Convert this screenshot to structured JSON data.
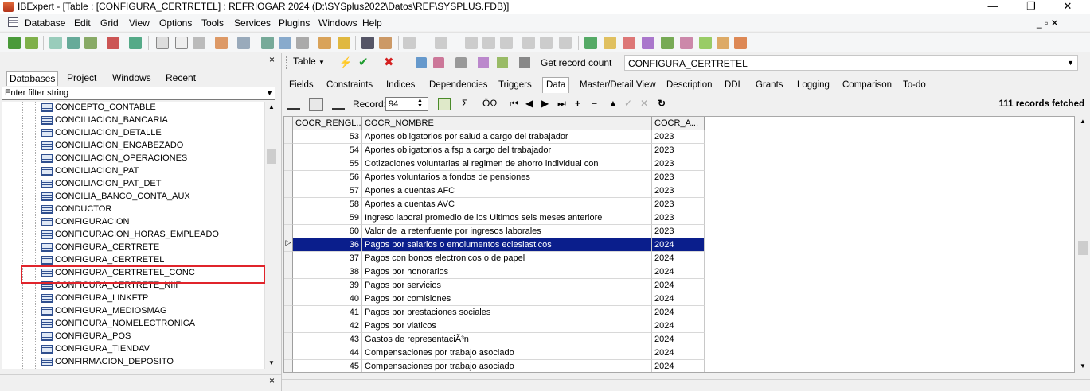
{
  "window": {
    "title": "IBExpert - [Table : [CONFIGURA_CERTRETEL] : REFRIOGAR 2024 (D:\\SYSplus2022\\Datos\\REF\\SYSPLUS.FDB)]",
    "min": "—",
    "max": "❐",
    "close": "✕"
  },
  "menu": [
    "Database",
    "Edit",
    "Grid",
    "View",
    "Options",
    "Tools",
    "Services",
    "Plugins",
    "Windows",
    "Help"
  ],
  "menu_right": "_ ▫ ✕",
  "left_panel": {
    "close": "×",
    "tabs": [
      "Databases",
      "Project",
      "Windows",
      "Recent"
    ],
    "active_tab": "Databases",
    "filter_placeholder": "Enter filter string",
    "tree_items": [
      "CONCEPTO_CONTABLE",
      "CONCILIACION_BANCARIA",
      "CONCILIACION_DETALLE",
      "CONCILIACION_ENCABEZADO",
      "CONCILIACION_OPERACIONES",
      "CONCILIACION_PAT",
      "CONCILIACION_PAT_DET",
      "CONCILIA_BANCO_CONTA_AUX",
      "CONDUCTOR",
      "CONFIGURACION",
      "CONFIGURACION_HORAS_EMPLEADO",
      "CONFIGURA_CERTRETE",
      "CONFIGURA_CERTRETEL",
      "CONFIGURA_CERTRETEL_CONC",
      "CONFIGURA_CERTRETE_NIIF",
      "CONFIGURA_LINKFTP",
      "CONFIGURA_MEDIOSMAG",
      "CONFIGURA_NOMELECTRONICA",
      "CONFIGURA_POS",
      "CONFIGURA_TIENDAV",
      "CONFIRMACION_DEPOSITO"
    ],
    "bottom_close": "×"
  },
  "right_panel": {
    "table_button": "Table",
    "get_record_count": "Get record count",
    "table_name": "CONFIGURA_CERTRETEL",
    "tabs": [
      "Fields",
      "Constraints",
      "Indices",
      "Dependencies",
      "Triggers",
      "Data",
      "Master/Detail View",
      "Description",
      "DDL",
      "Grants",
      "Logging",
      "Comparison",
      "To-do"
    ],
    "active_tab": "Data",
    "record_label": "Record:",
    "record_value": "94",
    "sum_symbol": "Σ",
    "oq_symbol": "ÖΩ",
    "fetched": "111 records fetched",
    "columns": [
      "COCR_RENGL...",
      "COCR_NOMBRE",
      "COCR_A..."
    ],
    "rows": [
      [
        "53",
        "Aportes obligatorios por salud a cargo del trabajador",
        "2023"
      ],
      [
        "54",
        "Aportes obligatorios a fsp a cargo del trabajador",
        "2023"
      ],
      [
        "55",
        "Cotizaciones voluntarias al regimen de ahorro individual con",
        "2023"
      ],
      [
        "56",
        "Aportes voluntarios a fondos de pensiones",
        "2023"
      ],
      [
        "57",
        "Aportes a  cuentas AFC",
        "2023"
      ],
      [
        "58",
        "Aportes a  cuentas AVC",
        "2023"
      ],
      [
        "59",
        "Ingreso laboral promedio de los Ultimos seis meses anteriore",
        "2023"
      ],
      [
        "60",
        "Valor de la retenfuente por ingresos laborales",
        "2023"
      ],
      [
        "36",
        "Pagos por salarios o emolumentos eclesiasticos",
        "2024"
      ],
      [
        "37",
        "Pagos con bonos electronicos o de papel",
        "2024"
      ],
      [
        "38",
        "Pagos por honorarios",
        "2024"
      ],
      [
        "39",
        "Pagos por servicios",
        "2024"
      ],
      [
        "40",
        "Pagos por comisiones",
        "2024"
      ],
      [
        "41",
        "Pagos por prestaciones sociales",
        "2024"
      ],
      [
        "42",
        "Pagos por viaticos",
        "2024"
      ],
      [
        "43",
        "Gastos de representaciÃ³n",
        "2024"
      ],
      [
        "44",
        "Compensaciones por trabajo asociado",
        "2024"
      ],
      [
        "45",
        "Compensaciones por trabajo asociado",
        "2024"
      ]
    ],
    "selected_row_index": 8,
    "row_indicator": "▷"
  },
  "colors": {
    "selection": "#0a1e8c",
    "highlight_box": "#e0242b"
  }
}
